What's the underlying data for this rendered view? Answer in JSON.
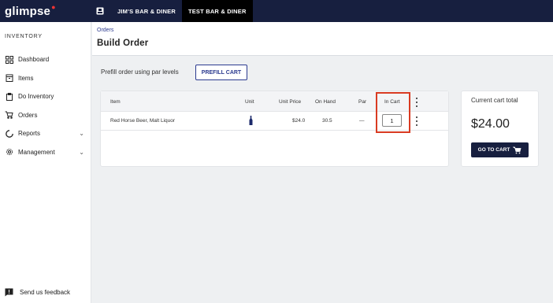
{
  "app": {
    "logo_text": "glimpse",
    "logo_dot": "●"
  },
  "topbar": {
    "location_icon": "building-icon",
    "tabs": [
      {
        "label": "JIM'S BAR & DINER"
      },
      {
        "label": "TEST BAR & DINER",
        "active": true
      }
    ]
  },
  "sidebar": {
    "heading": "INVENTORY",
    "items": [
      {
        "label": "Dashboard",
        "icon": "dashboard-icon"
      },
      {
        "label": "Items",
        "icon": "items-icon"
      },
      {
        "label": "Do Inventory",
        "icon": "clipboard-icon"
      },
      {
        "label": "Orders",
        "icon": "cart-icon"
      },
      {
        "label": "Reports",
        "icon": "reports-icon",
        "chevron": "⌄"
      },
      {
        "label": "Management",
        "icon": "gear-icon",
        "chevron": "⌄"
      }
    ],
    "feedback": "Send us feedback"
  },
  "header": {
    "breadcrumb": "Orders",
    "title": "Build Order"
  },
  "prefill": {
    "label": "Prefill order using par levels",
    "button": "PREFILL CART"
  },
  "table": {
    "columns": [
      "Item",
      "Unit",
      "Unit Price",
      "On Hand",
      "Par",
      "In Cart"
    ],
    "rows": [
      {
        "item": "Red Horse Beer, Malt Liquor",
        "unit": "bottle",
        "unit_price": "$24.0",
        "on_hand": "30.5",
        "par": "—",
        "in_cart": "1"
      }
    ]
  },
  "cart": {
    "title": "Current cart total",
    "total": "$24.00",
    "button": "GO TO CART"
  },
  "colors": {
    "nav": "#171f3f",
    "accent": "#2b3a8f",
    "highlight": "#d93b22"
  }
}
